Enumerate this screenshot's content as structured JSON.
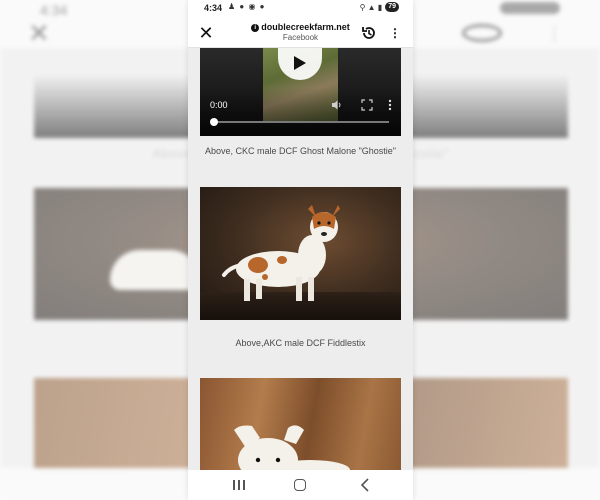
{
  "status": {
    "time": "4:34",
    "notif": "♟ ● ◉ ●",
    "signal": "⚲ ▲ ▮",
    "battery": "79"
  },
  "browser": {
    "domain": "doublecreekfarm.net",
    "subtitle": "Facebook"
  },
  "video": {
    "time": "0:00",
    "progress": 0.0
  },
  "posts": [
    {
      "caption": "Above, CKC male DCF Ghost Malone \"Ghostie\""
    },
    {
      "caption": "Above,AKC male DCF Fiddlestix"
    }
  ],
  "colors": {
    "photo_bg": "#3f2d1f",
    "floor_wood": "#a97446",
    "dog_white": "#f4f1ea",
    "dog_tan": "#b8672c"
  },
  "icons": [
    "close-icon",
    "info-icon",
    "history-icon",
    "more-vert-icon",
    "play-icon",
    "volume-icon",
    "fullscreen-icon",
    "recents-icon",
    "home-icon",
    "back-icon"
  ]
}
